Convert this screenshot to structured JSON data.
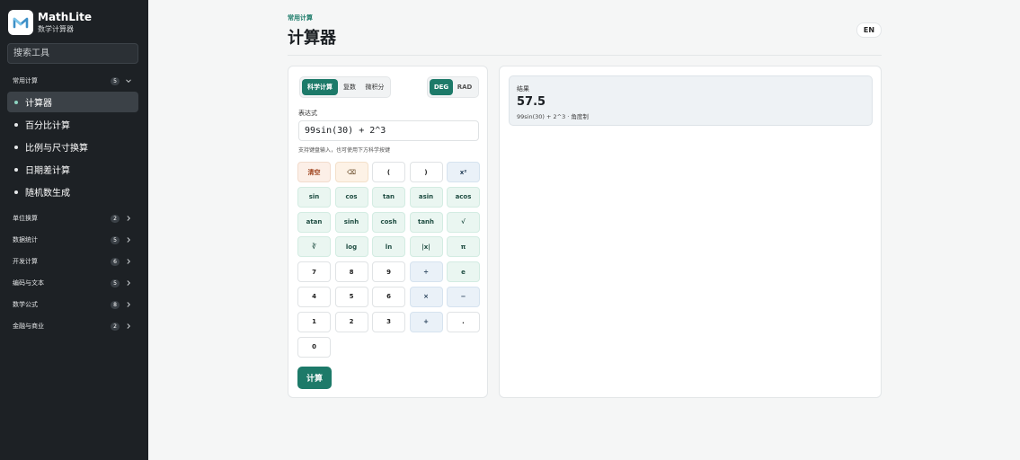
{
  "app": {
    "name": "MathLite",
    "subtitle": "数学计算器"
  },
  "sidebar": {
    "search_placeholder": "搜索工具",
    "groups": [
      {
        "label": "常用计算",
        "count": "5",
        "expanded": true,
        "items": [
          {
            "label": "计算器",
            "active": true
          },
          {
            "label": "百分比计算"
          },
          {
            "label": "比例与尺寸换算"
          },
          {
            "label": "日期差计算"
          },
          {
            "label": "随机数生成"
          }
        ]
      },
      {
        "label": "单位换算",
        "count": "2"
      },
      {
        "label": "数据统计",
        "count": "5"
      },
      {
        "label": "开发计算",
        "count": "6"
      },
      {
        "label": "编码与文本",
        "count": "5"
      },
      {
        "label": "数学公式",
        "count": "8"
      },
      {
        "label": "金融与商业",
        "count": "2"
      }
    ]
  },
  "header": {
    "breadcrumb": "常用计算",
    "title": "计算器",
    "lang_button": "EN"
  },
  "calculator": {
    "modes": [
      "科学计算",
      "复数",
      "微积分"
    ],
    "active_mode": "科学计算",
    "angle_units": [
      "DEG",
      "RAD"
    ],
    "active_angle": "DEG",
    "expression_label": "表达式",
    "expression_value": "99sin(30) + 2^3",
    "hint": "支持键盘输入，也可使用下方科学按键",
    "keys": [
      {
        "label": "清空",
        "kind": "danger",
        "name": "clear"
      },
      {
        "label": "⌫",
        "kind": "warn",
        "name": "backspace"
      },
      {
        "label": "(",
        "kind": "plain",
        "name": "paren-open"
      },
      {
        "label": ")",
        "kind": "plain",
        "name": "paren-close"
      },
      {
        "label": "x²",
        "kind": "op",
        "name": "power"
      },
      {
        "label": "sin",
        "kind": "fn",
        "name": "sin"
      },
      {
        "label": "cos",
        "kind": "fn",
        "name": "cos"
      },
      {
        "label": "tan",
        "kind": "fn",
        "name": "tan"
      },
      {
        "label": "asin",
        "kind": "fn",
        "name": "asin"
      },
      {
        "label": "acos",
        "kind": "fn",
        "name": "acos"
      },
      {
        "label": "atan",
        "kind": "fn",
        "name": "atan"
      },
      {
        "label": "sinh",
        "kind": "fn",
        "name": "sinh"
      },
      {
        "label": "cosh",
        "kind": "fn",
        "name": "cosh"
      },
      {
        "label": "tanh",
        "kind": "fn",
        "name": "tanh"
      },
      {
        "label": "√",
        "kind": "fn",
        "name": "sqrt"
      },
      {
        "label": "∛",
        "kind": "fn",
        "name": "cbrt"
      },
      {
        "label": "log",
        "kind": "fn",
        "name": "log"
      },
      {
        "label": "ln",
        "kind": "fn",
        "name": "ln"
      },
      {
        "label": "|x|",
        "kind": "fn",
        "name": "abs"
      },
      {
        "label": "π",
        "kind": "fn",
        "name": "pi"
      },
      {
        "label": "7",
        "kind": "plain",
        "name": "digit-7"
      },
      {
        "label": "8",
        "kind": "plain",
        "name": "digit-8"
      },
      {
        "label": "9",
        "kind": "plain",
        "name": "digit-9"
      },
      {
        "label": "÷",
        "kind": "op",
        "name": "divide"
      },
      {
        "label": "e",
        "kind": "fn",
        "name": "euler"
      },
      {
        "label": "4",
        "kind": "plain",
        "name": "digit-4"
      },
      {
        "label": "5",
        "kind": "plain",
        "name": "digit-5"
      },
      {
        "label": "6",
        "kind": "plain",
        "name": "digit-6"
      },
      {
        "label": "×",
        "kind": "op",
        "name": "multiply"
      },
      {
        "label": "−",
        "kind": "op",
        "name": "subtract"
      },
      {
        "label": "1",
        "kind": "plain",
        "name": "digit-1"
      },
      {
        "label": "2",
        "kind": "plain",
        "name": "digit-2"
      },
      {
        "label": "3",
        "kind": "plain",
        "name": "digit-3"
      },
      {
        "label": "+",
        "kind": "op",
        "name": "add"
      },
      {
        "label": ".",
        "kind": "plain",
        "name": "decimal"
      },
      {
        "label": "0",
        "kind": "plain",
        "name": "digit-0"
      }
    ],
    "compute_button": "计算"
  },
  "result": {
    "label": "结果",
    "value": "57.5",
    "description": "99sin(30) + 2^3 · 角度制"
  },
  "colors": {
    "accent": "#1d7a69",
    "sidebar_bg": "#1d2125"
  }
}
